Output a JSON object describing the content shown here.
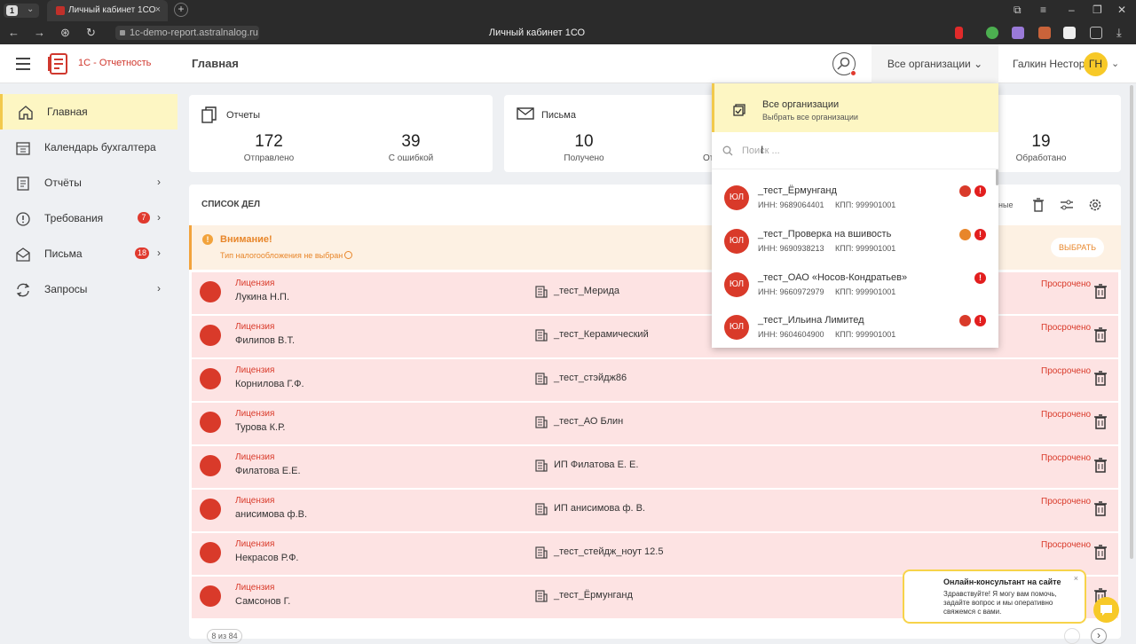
{
  "browser": {
    "workspace": "1",
    "tab_title": "Личный кабинет 1СО",
    "url": "1c-demo-report.astralnalog.ru",
    "page_title": "Личный кабинет 1СО"
  },
  "header": {
    "brand": "1С - Отчетность",
    "title": "Главная",
    "org_selector": "Все организации",
    "user_name": "Галкин Нестор",
    "user_initials": "ГН"
  },
  "sidebar": {
    "items": [
      {
        "label": "Главная",
        "icon": "home-icon"
      },
      {
        "label": "Календарь бухгалтера",
        "icon": "calendar-icon"
      },
      {
        "label": "Отчёты",
        "icon": "reports-icon"
      },
      {
        "label": "Требования",
        "icon": "alert-icon",
        "badge": "7"
      },
      {
        "label": "Письма",
        "icon": "mail-icon",
        "badge": "18"
      },
      {
        "label": "Запросы",
        "icon": "sync-icon"
      }
    ]
  },
  "stats": {
    "reports": {
      "title": "Отчеты",
      "sent_value": "172",
      "sent_label": "Отправлено",
      "error_value": "39",
      "error_label": "С ошибкой"
    },
    "letters": {
      "title": "Письма",
      "received_value": "10",
      "received_label": "Получено",
      "partial_label": "От"
    },
    "processed": {
      "value": "19",
      "label": "Обработано"
    }
  },
  "list": {
    "title": "СПИСОК ДЕЛ",
    "partial_label": "ные",
    "warning": {
      "title": "Внимание!",
      "subtitle": "Тип налогообложения не выбран",
      "button": "ВЫБРАТЬ"
    },
    "rows": [
      {
        "kind": "Лицензия",
        "person": "Лукина Н.П.",
        "org": "_тест_Мерида",
        "status": "Просрочено"
      },
      {
        "kind": "Лицензия",
        "person": "Филипов В.Т.",
        "org": "_тест_Керамический",
        "status": "Просрочено"
      },
      {
        "kind": "Лицензия",
        "person": "Корнилова Г.Ф.",
        "org": "_тест_стэйдж86",
        "status": "Просрочено"
      },
      {
        "kind": "Лицензия",
        "person": "Турова К.Р.",
        "org": "_тест_АО Блин",
        "status": "Просрочено"
      },
      {
        "kind": "Лицензия",
        "person": "Филатова Е.Е.",
        "org": "ИП Филатова Е. Е.",
        "status": "Просрочено"
      },
      {
        "kind": "Лицензия",
        "person": "анисимова ф.В.",
        "org": "ИП анисимова ф. В.",
        "status": "Просрочено"
      },
      {
        "kind": "Лицензия",
        "person": "Некрасов Р.Ф.",
        "org": "_тест_стейдж_ноут 12.5",
        "status": "Просрочено"
      },
      {
        "kind": "Лицензия",
        "person": "Самсонов Г.",
        "org": "_тест_Ёрмунганд",
        "status": ""
      }
    ],
    "pager": "8 из 84"
  },
  "dropdown": {
    "all_title": "Все организации",
    "all_subtitle": "Выбрать все организации",
    "search_placeholder": "Поиск ...",
    "orgs": [
      {
        "avatar": "ЮЛ",
        "name": "_тест_Ёрмунганд",
        "inn": "ИНН: 9689064401",
        "kpp": "КПП: 999901001",
        "license_badge": "red"
      },
      {
        "avatar": "ЮЛ",
        "name": "_тест_Проверка на вшивость",
        "inn": "ИНН: 9690938213",
        "kpp": "КПП: 999901001",
        "license_badge": "orange"
      },
      {
        "avatar": "ЮЛ",
        "name": "_тест_ОАО «Носов-Кондратьев»",
        "inn": "ИНН: 9660972979",
        "kpp": "КПП: 999901001",
        "license_badge": "none"
      },
      {
        "avatar": "ЮЛ",
        "name": "_тест_Ильина Лимитед",
        "inn": "ИНН: 9604604900",
        "kpp": "КПП: 999901001",
        "license_badge": "red"
      }
    ]
  },
  "chat": {
    "title": "Онлайн-консультант на сайте",
    "body": "Здравствуйте! Я могу вам помочь, задайте вопрос и мы оперативно свяжемся с вами."
  },
  "colors": {
    "accent": "#d0382e",
    "highlight": "#fdf6c3",
    "overdue_bg": "#fde3e3",
    "warning": "#e8862a"
  }
}
